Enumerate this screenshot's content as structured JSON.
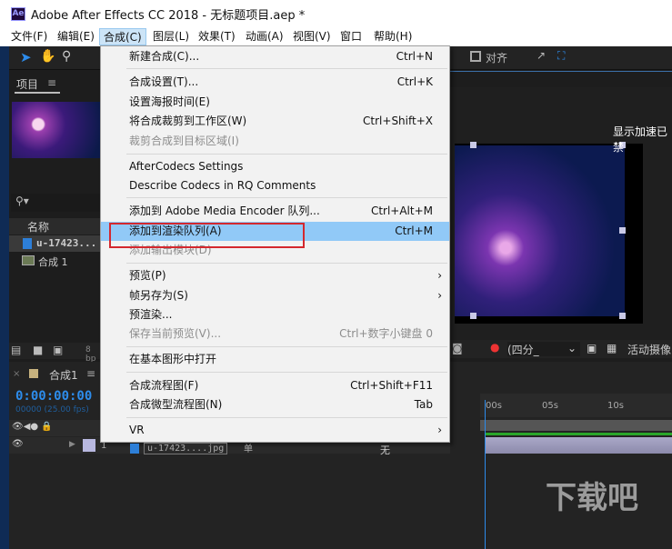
{
  "window": {
    "app_icon": "Ae",
    "title": "Adobe After Effects CC 2018 - 无标题项目.aep *"
  },
  "menubar": [
    "文件(F)",
    "编辑(E)",
    "合成(C)",
    "图层(L)",
    "效果(T)",
    "动画(A)",
    "视图(V)",
    "窗口",
    "帮助(H)"
  ],
  "toolbar": {
    "snap_label": "对齐"
  },
  "project": {
    "tab": "项目",
    "column_name": "名称",
    "items": [
      "u-17423...",
      "合成 1"
    ],
    "bit_depth": "8 bp"
  },
  "viewer": {
    "gpu_notice": "显示加速已禁",
    "resolution": "(四分_",
    "camera": "活动摄像"
  },
  "timeline": {
    "tab": "合成1",
    "timecode": "0:00:00:00",
    "fps": "00000 (25.00 fps)",
    "ruler": [
      "00s",
      "05s",
      "10s"
    ],
    "layer_num": "1",
    "layer_name": "u-17423....jpg",
    "layer_mode": "单",
    "parent": "无"
  },
  "menu": {
    "items": [
      {
        "label": "新建合成(C)...",
        "shortcut": "Ctrl+N"
      },
      {
        "label": "合成设置(T)...",
        "shortcut": "Ctrl+K"
      },
      {
        "label": "设置海报时间(E)",
        "shortcut": ""
      },
      {
        "label": "将合成裁剪到工作区(W)",
        "shortcut": "Ctrl+Shift+X"
      },
      {
        "label": "裁剪合成到目标区域(I)",
        "shortcut": "",
        "disabled": true
      },
      {
        "label": "AfterCodecs Settings",
        "shortcut": ""
      },
      {
        "label": "Describe Codecs in RQ Comments",
        "shortcut": ""
      },
      {
        "label": "添加到 Adobe Media Encoder 队列...",
        "shortcut": "Ctrl+Alt+M"
      },
      {
        "label": "添加到渲染队列(A)",
        "shortcut": "Ctrl+M",
        "highlighted": true
      },
      {
        "label": "添加输出模块(D)",
        "shortcut": "",
        "disabled": true
      },
      {
        "label": "预览(P)",
        "shortcut": "",
        "submenu": true
      },
      {
        "label": "帧另存为(S)",
        "shortcut": "",
        "submenu": true
      },
      {
        "label": "预渲染...",
        "shortcut": ""
      },
      {
        "label": "保存当前预览(V)...",
        "shortcut": "Ctrl+数字小键盘 0",
        "disabled": true
      },
      {
        "label": "在基本图形中打开",
        "shortcut": ""
      },
      {
        "label": "合成流程图(F)",
        "shortcut": "Ctrl+Shift+F11"
      },
      {
        "label": "合成微型流程图(N)",
        "shortcut": "Tab"
      },
      {
        "label": "VR",
        "shortcut": "",
        "submenu": true
      }
    ]
  },
  "watermark": "下载吧"
}
